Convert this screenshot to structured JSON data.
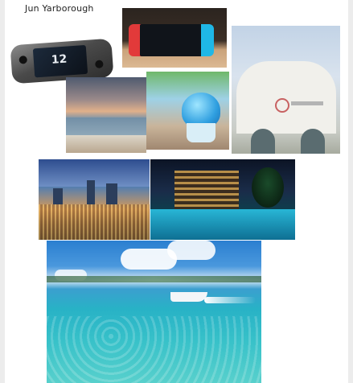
{
  "board": {
    "author_name": "Jun Yarborough"
  },
  "photos": {
    "handheld": {
      "screen_time": "12"
    },
    "switch": {
      "joycon_colors": [
        "#e23a3a",
        "#1fb7e6"
      ]
    },
    "sunset": {},
    "shaved_ice": {},
    "building": {},
    "city": {},
    "hotel": {},
    "sea": {}
  }
}
